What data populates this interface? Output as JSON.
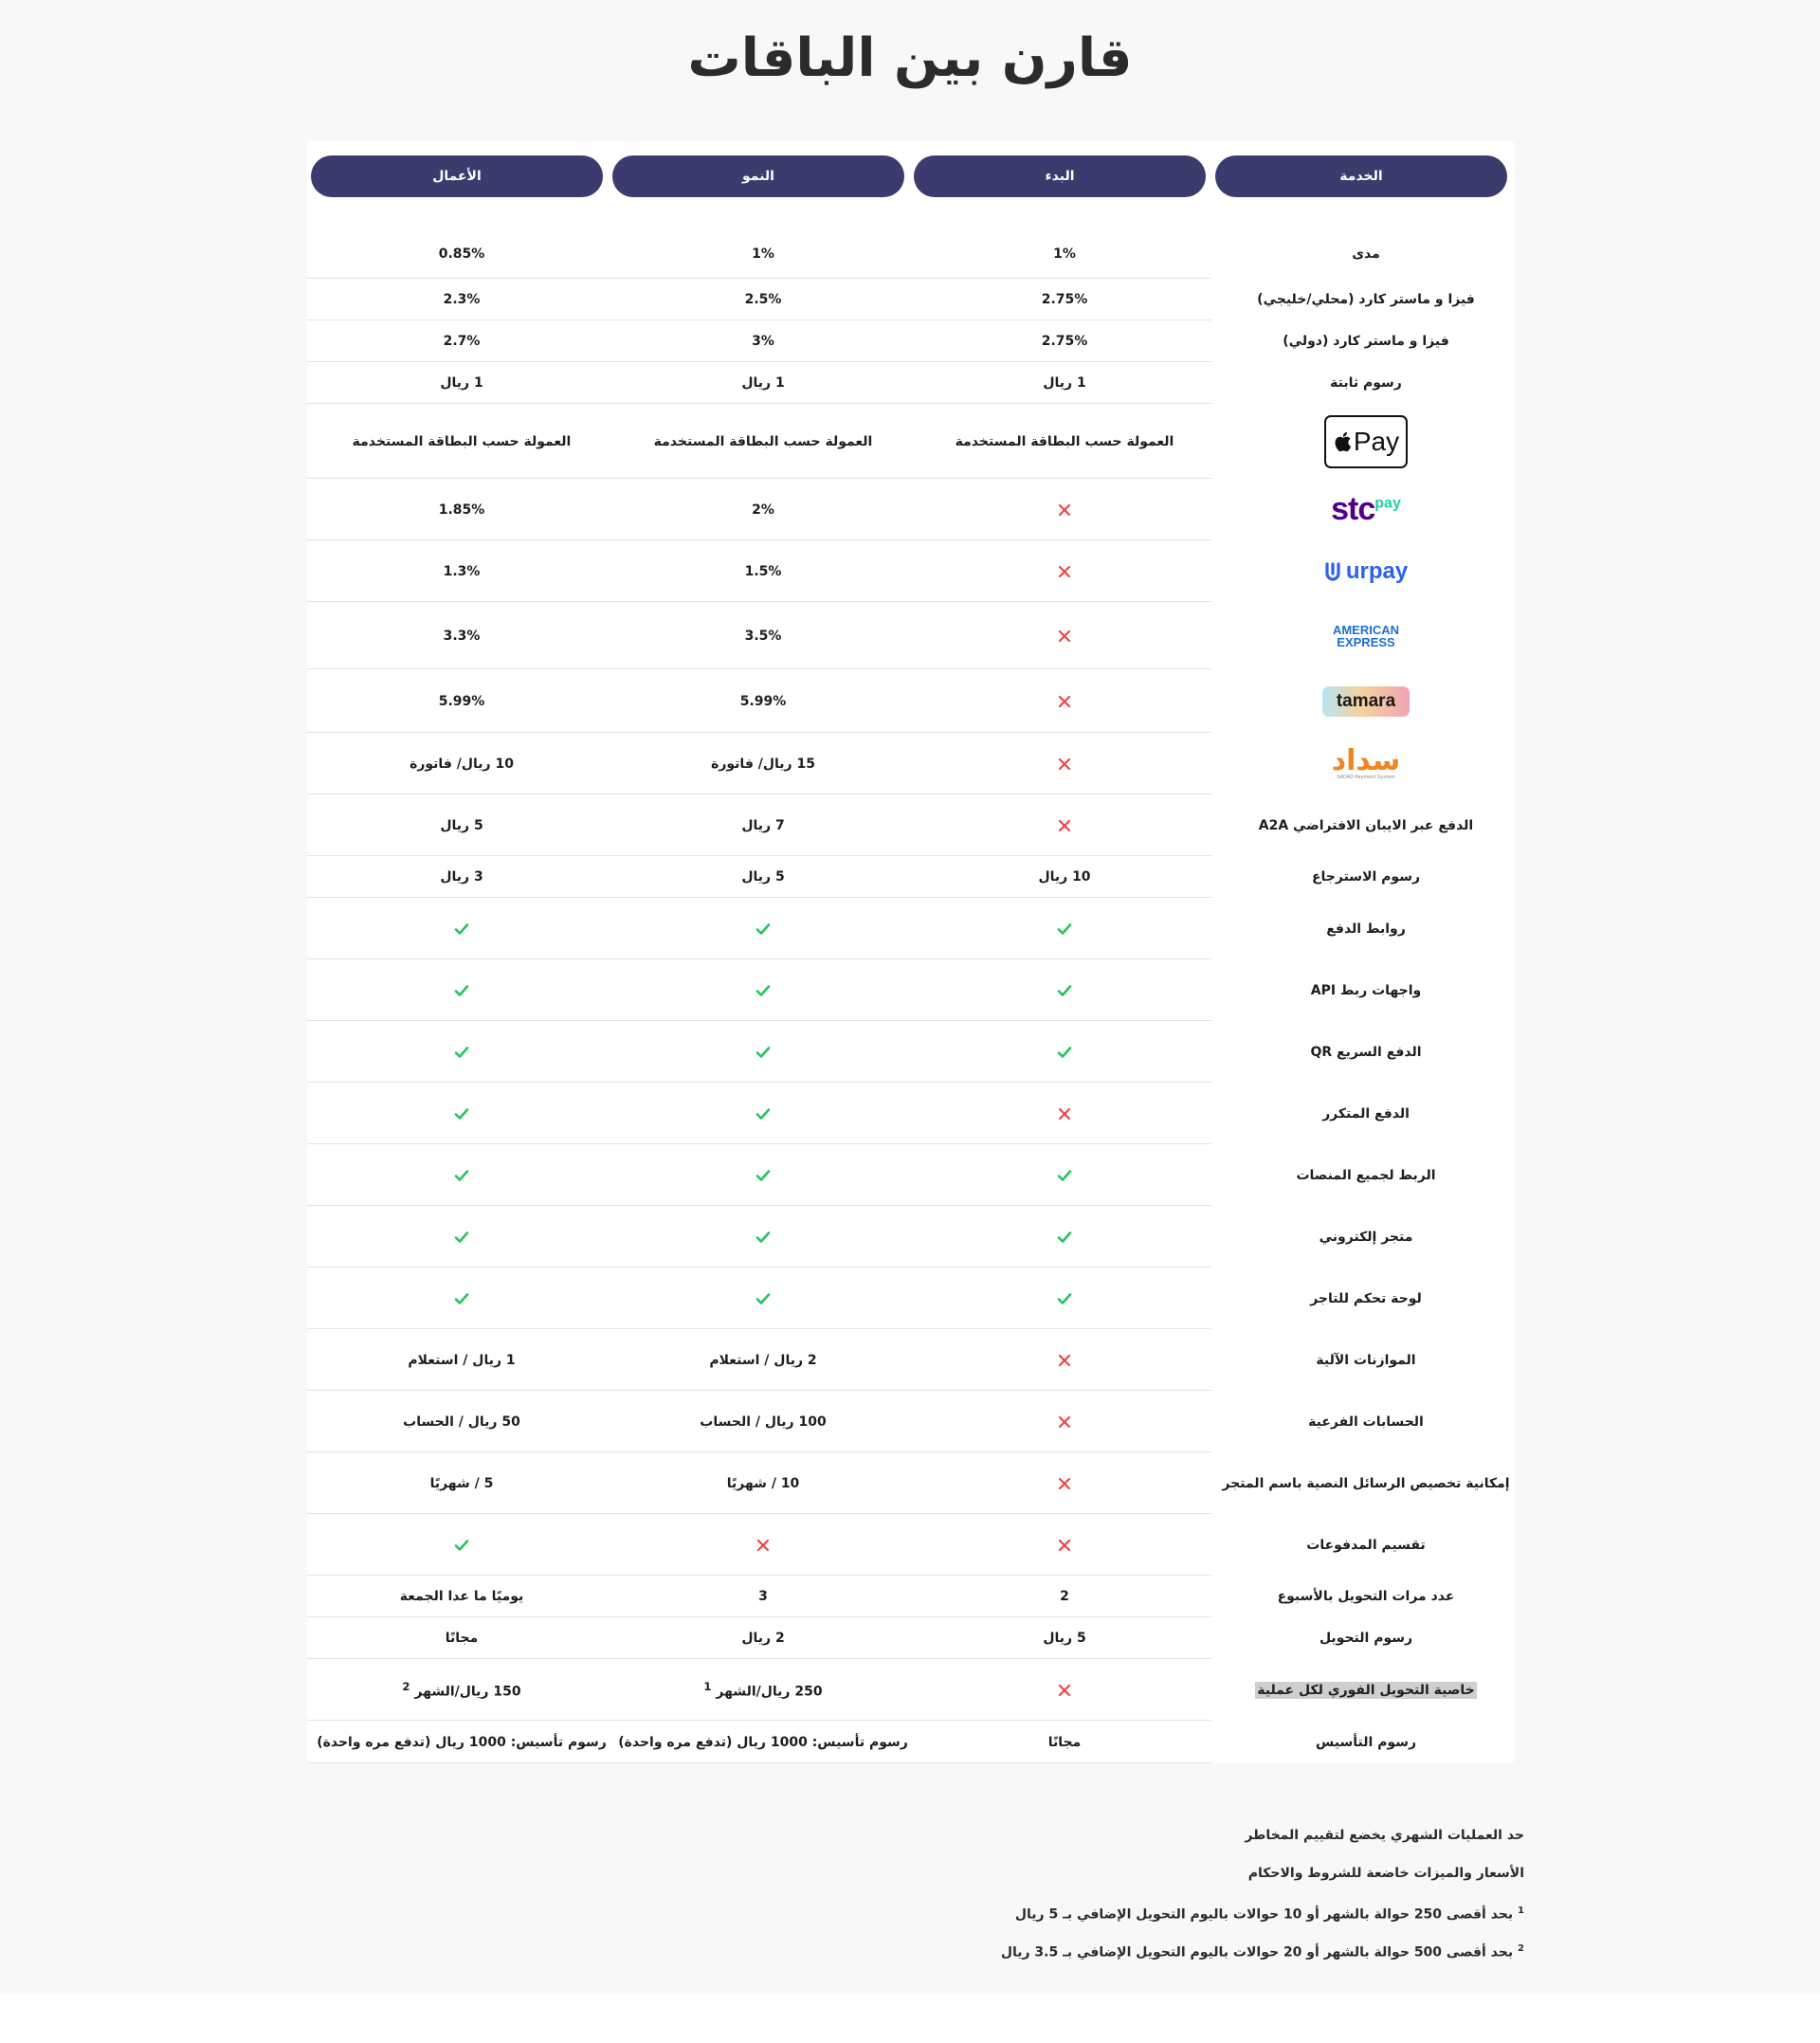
{
  "page_title": "قارن بين الباقات",
  "headers": {
    "service": "الخدمة",
    "start": "البدء",
    "growth": "النمو",
    "business": "الأعمال"
  },
  "logos": {
    "applepay_text": "Pay",
    "stc_main": "stc",
    "stc_pay": "pay",
    "urpay_text": "urpay",
    "amex_line1": "AMERICAN",
    "amex_line2": "EXPRESS",
    "tamara_text": "tamara",
    "sadad_text": "سداد",
    "sadad_sub": "SADAD Payment System"
  },
  "rows": [
    {
      "label": "مدى",
      "start": "1%",
      "growth": "1%",
      "business": "0.85%"
    },
    {
      "label": "فيزا و ماستر كارد (محلي/خليجي)",
      "start": "2.75%",
      "growth": "2.5%",
      "business": "2.3%"
    },
    {
      "label": "فيزا و ماستر كارد (دولي)",
      "start": "2.75%",
      "growth": "3%",
      "business": "2.7%"
    },
    {
      "label": "رسوم ثابتة",
      "start": "1 ريال",
      "growth": "1 ريال",
      "business": "1 ريال"
    },
    {
      "label": "applepay-logo",
      "start": "العمولة حسب البطاقة المستخدمة",
      "growth": "العمولة حسب البطاقة المستخدمة",
      "business": "العمولة حسب البطاقة المستخدمة"
    },
    {
      "label": "stcpay-logo",
      "start": "cross",
      "growth": "2%",
      "business": "1.85%"
    },
    {
      "label": "urpay-logo",
      "start": "cross",
      "growth": "1.5%",
      "business": "1.3%"
    },
    {
      "label": "amex-logo",
      "start": "cross",
      "growth": "3.5%",
      "business": "3.3%"
    },
    {
      "label": "tamara-logo",
      "start": "cross",
      "growth": "5.99%",
      "business": "5.99%"
    },
    {
      "label": "sadad-logo",
      "start": "cross",
      "growth": "15 ريال/ فاتورة",
      "business": "10 ريال/ فاتورة"
    },
    {
      "label": "الدفع عبر الايبان الافتراضي A2A",
      "start": "cross",
      "growth": "7 ريال",
      "business": "5 ريال"
    },
    {
      "label": "رسوم الاسترجاع",
      "start": "10 ريال",
      "growth": "5 ريال",
      "business": "3 ريال"
    },
    {
      "label": "روابط الدفع",
      "start": "check",
      "growth": "check",
      "business": "check"
    },
    {
      "label": "واجهات ربط API",
      "start": "check",
      "growth": "check",
      "business": "check"
    },
    {
      "label": "الدفع السريع QR",
      "start": "check",
      "growth": "check",
      "business": "check"
    },
    {
      "label": "الدفع المتكرر",
      "start": "cross",
      "growth": "check",
      "business": "check"
    },
    {
      "label": "الربط لجميع المنصات",
      "start": "check",
      "growth": "check",
      "business": "check"
    },
    {
      "label": "متجر إلكتروني",
      "start": "check",
      "growth": "check",
      "business": "check"
    },
    {
      "label": "لوحة تحكم للتاجر",
      "start": "check",
      "growth": "check",
      "business": "check"
    },
    {
      "label": "الموازنات الآلية",
      "start": "cross",
      "growth": "2 ريال / استعلام",
      "business": "1 ريال / استعلام"
    },
    {
      "label": "الحسابات الفرعية",
      "start": "cross",
      "growth": "100 ريال / الحساب",
      "business": "50 ريال / الحساب"
    },
    {
      "label": "إمكانية تخصيص الرسائل النصية باسم المتجر",
      "start": "cross",
      "growth": "10 / شهريًا",
      "business": "5 / شهريًا"
    },
    {
      "label": "تقسيم المدفوعات",
      "start": "cross",
      "growth": "cross",
      "business": "check"
    },
    {
      "label": "عدد مرات التحويل بالأسبوع",
      "start": "2",
      "growth": "3",
      "business": "يوميًا ما عدا الجمعة"
    },
    {
      "label": "رسوم التحويل",
      "start": "5 ريال",
      "growth": "2 ريال",
      "business": "مجانًا"
    },
    {
      "label": "خاصية التحويل الفوري لكل عملية",
      "start": "cross",
      "growth": "250 ريال/الشهر",
      "business": "150 ريال/الشهر"
    },
    {
      "label": "رسوم التأسيس",
      "start": "مجانًا",
      "growth": "رسوم تأسيس: 1000 ريال (تدفع مره واحدة)",
      "business": "رسوم تأسيس: 1000 ريال (تدفع مره واحدة)"
    }
  ],
  "footnote_marks": {
    "growth_instant": "1",
    "business_instant": "2"
  },
  "notes": [
    {
      "mark": "",
      "text": "حد العمليات الشهري يخضع لتقييم المخاطر"
    },
    {
      "mark": "",
      "text": "الأسعار والميزات خاضعة للشروط والاحكام"
    },
    {
      "mark": "1",
      "text": "بحد أقصى 250 حوالة بالشهر أو 10 حوالات باليوم التحويل الإضافي بـ 5 ريال"
    },
    {
      "mark": "2",
      "text": "بحد أقصى 500 حوالة بالشهر أو 20 حوالات باليوم التحويل الإضافي بـ 3.5 ريال"
    }
  ],
  "colors": {
    "header_bg": "#3b3b6d",
    "check": "#22c55e",
    "cross": "#ef4444"
  }
}
